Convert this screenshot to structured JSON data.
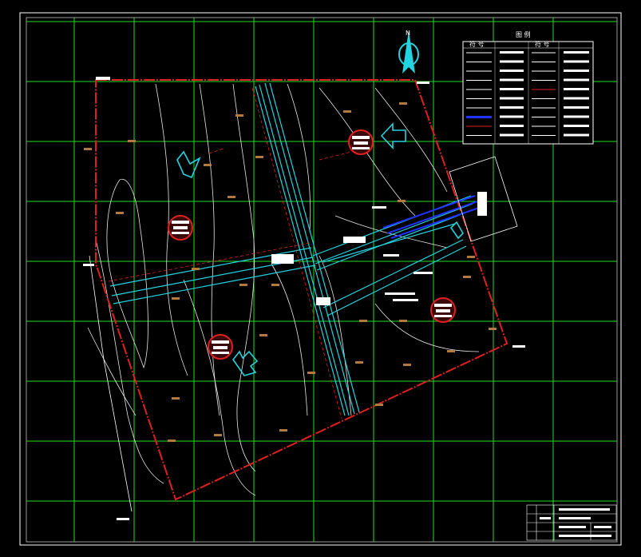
{
  "drawing": {
    "legend_title": "图 例",
    "legend_header": [
      "符 号",
      "",
      "符 号",
      ""
    ],
    "compass_letter": "N",
    "colors": {
      "background": "#000000",
      "grid": "#22dd22",
      "boundary": "#e02020",
      "road": "#22d4e0",
      "contour": "#e8e8e8",
      "pipe": "#2233ff",
      "frame": "#ffffff"
    },
    "icons": [
      "compass-icon",
      "flow-arrow-icon",
      "warehouse-symbol-icon"
    ]
  }
}
